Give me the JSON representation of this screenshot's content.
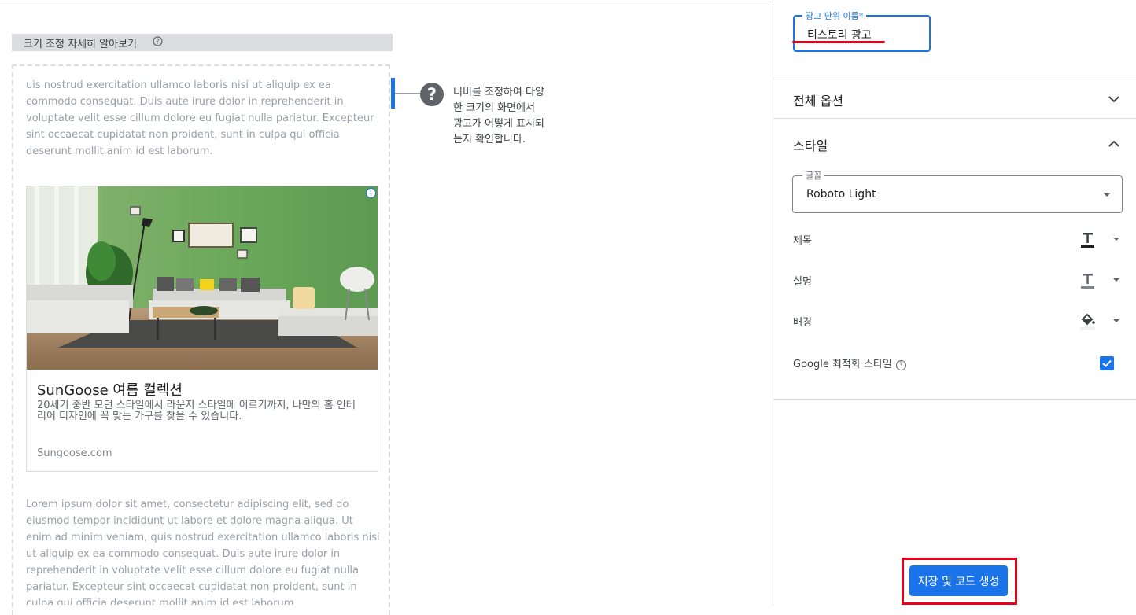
{
  "preview": {
    "resize_help_label": "크기 조정 자세히 알아보기",
    "help_symbol": "?",
    "top_text": "uis nostrud exercitation ullamco laboris nisi ut aliquip ex ea commodo consequat. Duis aute irure dolor in reprehenderit in voluptate velit esse cillum dolore eu fugiat nulla pariatur. Excepteur sint occaecat cupidatat non proident, sunt in culpa qui officia deserunt mollit anim id est laborum.",
    "bottom_text": "Lorem ipsum dolor sit amet, consectetur adipiscing elit, sed do eiusmod tempor incididunt ut labore et dolore magna aliqua. Ut enim ad minim veniam, quis nostrud exercitation ullamco laboris nisi ut aliquip ex ea commodo consequat. Duis aute irure dolor in reprehenderit in voluptate velit esse cillum dolore eu fugiat nulla pariatur. Excepteur sint occaecat cupidatat non proident, sunt in culpa qui officia deserunt mollit anim id est laborum.",
    "resize_tooltip": "너비를 조정하여 다양한 크기의 화면에서 광고가 어떻게 표시되는지 확인합니다.",
    "ad": {
      "info_icon": "i",
      "title": "SunGoose 여름 컬렉션",
      "description": "20세기 중반 모던 스타일에서 라운지 스타일에 이르기까지, 나만의 홈 인테리어 디자인에 꼭 맞는 가구를 찾을 수 있습니다.",
      "url": "Sungoose.com"
    }
  },
  "panel": {
    "ad_unit_name_label": "광고 단위 이름*",
    "ad_unit_name_value": "티스토리 광고",
    "sections": {
      "all_options": "전체 옵션",
      "style": "스타일"
    },
    "font": {
      "label": "글꼴",
      "value": "Roboto Light"
    },
    "style_rows": {
      "title": "제목",
      "description": "설명",
      "background": "배경",
      "google_optimized": "Google 최적화 스타일",
      "google_optimized_checked": true
    },
    "save_button": "저장 및 코드 생성"
  },
  "colors": {
    "accent": "#1a73e8",
    "highlight_red": "#e8001c"
  }
}
